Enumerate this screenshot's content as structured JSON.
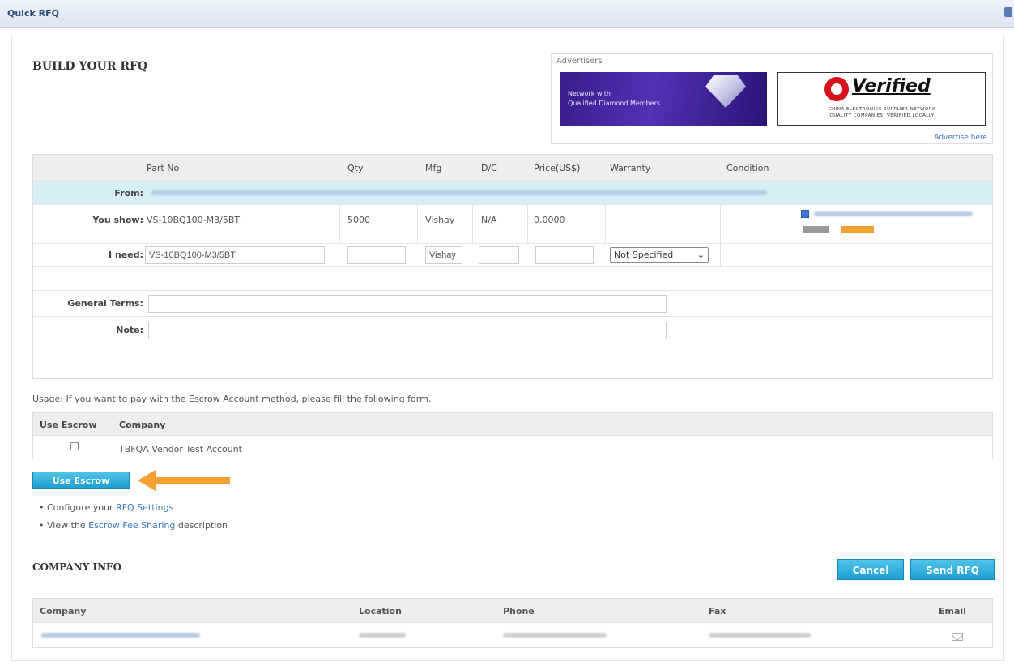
{
  "window": {
    "title": "Quick RFQ"
  },
  "build_heading": "BUILD YOUR RFQ",
  "ads": {
    "label": "Advertisers",
    "ad1_line1": "Network with",
    "ad1_line2": "Qualified Diamond Members",
    "ad2_title": "Verified",
    "ad2_line1": "CHINA ELECTRONICS SUPPLIER NETWORK",
    "ad2_line2": "QUALITY COMPANIES, VERIFIED LOCALLY",
    "advertise_link": "Advertise here"
  },
  "rfq_table": {
    "headers": [
      "Part No",
      "Qty",
      "Mfg",
      "D/C",
      "Price(US$)",
      "Warranty",
      "Condition"
    ],
    "from_label": "From:",
    "show": {
      "label": "You show:",
      "part_no": "VS-10BQ100-M3/5BT",
      "qty": "5000",
      "mfg": "Vishay",
      "dc": "N/A",
      "price": "0.0000",
      "vendor_checked": true
    },
    "need": {
      "label": "I need:",
      "part_no": "VS-10BQ100-M3/5BT",
      "qty": "",
      "mfg": "Vishay",
      "dc": "",
      "price": "",
      "warranty_selected": "Not Specified"
    },
    "general_terms_label": "General Terms:",
    "general_terms_value": "",
    "note_label": "Note:",
    "note_value": ""
  },
  "usage_text": "Usage: If you want to pay with the Escrow Account method, please fill the following form.",
  "escrow_table": {
    "headers": [
      "Use Escrow",
      "Company"
    ],
    "rows": [
      {
        "checked": false,
        "company": "TBFQA Vendor Test Account"
      }
    ]
  },
  "use_escrow_button": "Use Escrow",
  "links": {
    "config_pre": "Configure your ",
    "config_link": "RFQ Settings",
    "view_pre": "View the ",
    "view_link": "Escrow Fee Sharing",
    "view_post": " description"
  },
  "company_info": {
    "heading": "COMPANY INFO",
    "cancel_button": "Cancel",
    "send_button": "Send RFQ",
    "headers": [
      "Company",
      "Location",
      "Phone",
      "Fax",
      "Email"
    ]
  },
  "colors": {
    "accent": "#1f9fd3",
    "arrow": "#f5a033",
    "from_row": "#d7eef6"
  }
}
